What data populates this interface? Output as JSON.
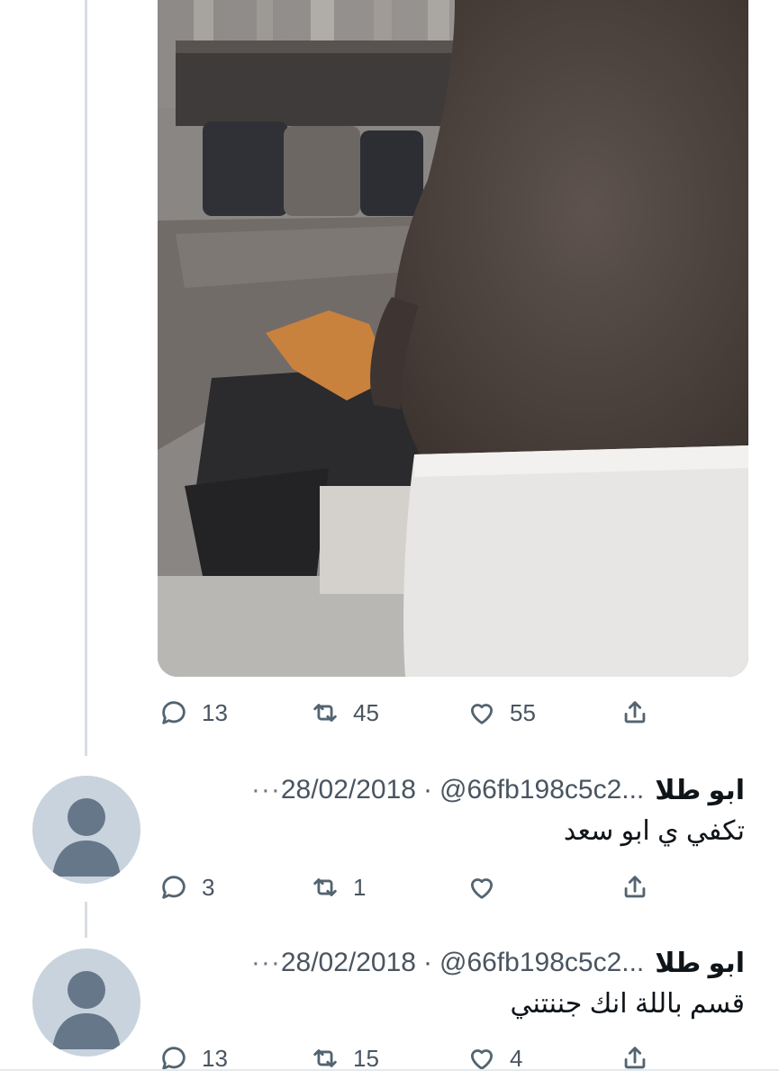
{
  "tweet": {
    "actions": {
      "reply_count": "13",
      "retweet_count": "45",
      "like_count": "55"
    }
  },
  "replies": [
    {
      "name": "ابو طلا",
      "handle": "@66fb198c5c2...",
      "separator": "·",
      "date": "28/02/2018",
      "more": "···",
      "text": "تكفي ي ابو سعد",
      "reply_count": "3",
      "retweet_count": "1",
      "like_count": ""
    },
    {
      "name": "ابو طلا",
      "handle": "@66fb198c5c2...",
      "separator": "·",
      "date": "28/02/2018",
      "more": "···",
      "text": "قسم باللة انك جننتني",
      "reply_count": "13",
      "retweet_count": "15",
      "like_count": "4"
    }
  ],
  "icons": {
    "reply": "speech-bubble-icon",
    "retweet": "retweet-arrows-icon",
    "like": "heart-icon",
    "share": "share-upload-icon",
    "avatar": "default-profile-icon"
  },
  "colors": {
    "icon_gray": "#536471",
    "text_primary": "#0f1419",
    "text_secondary": "#4a5561",
    "avatar_bg": "#c8d3dd",
    "avatar_figure": "#66778a"
  }
}
